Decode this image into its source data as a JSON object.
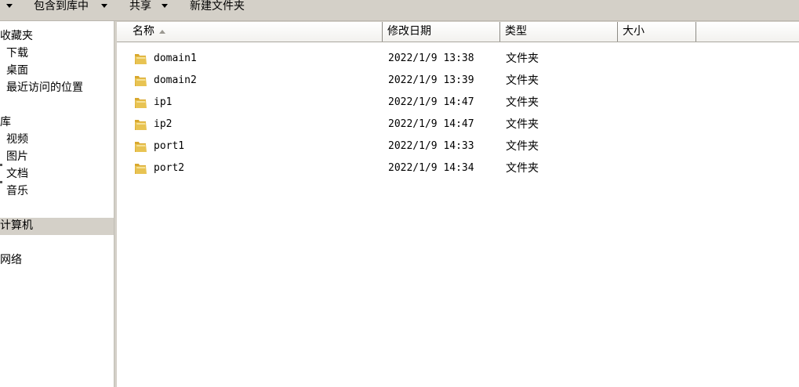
{
  "toolbar": {
    "include_in_library": "包含到库中",
    "share": "共享",
    "new_folder": "新建文件夹"
  },
  "sidebar": {
    "favorites": "收藏夹",
    "downloads": "下载",
    "desktop": "桌面",
    "recent_places": "最近访问的位置",
    "libraries": "库",
    "videos": "视频",
    "pictures": "图片",
    "documents": "文档",
    "music": "音乐",
    "computer": "计算机",
    "network": "网络"
  },
  "columns": {
    "name": "名称",
    "modified": "修改日期",
    "type": "类型",
    "size": "大小"
  },
  "files": [
    {
      "name": "domain1",
      "modified": "2022/1/9 13:38",
      "type": "文件夹",
      "size": ""
    },
    {
      "name": "domain2",
      "modified": "2022/1/9 13:39",
      "type": "文件夹",
      "size": ""
    },
    {
      "name": "ip1",
      "modified": "2022/1/9 14:47",
      "type": "文件夹",
      "size": ""
    },
    {
      "name": "ip2",
      "modified": "2022/1/9 14:47",
      "type": "文件夹",
      "size": ""
    },
    {
      "name": "port1",
      "modified": "2022/1/9 14:33",
      "type": "文件夹",
      "size": ""
    },
    {
      "name": "port2",
      "modified": "2022/1/9 14:34",
      "type": "文件夹",
      "size": ""
    }
  ],
  "colors": {
    "chrome": "#d4d0c8",
    "folder": "#e8c352"
  }
}
